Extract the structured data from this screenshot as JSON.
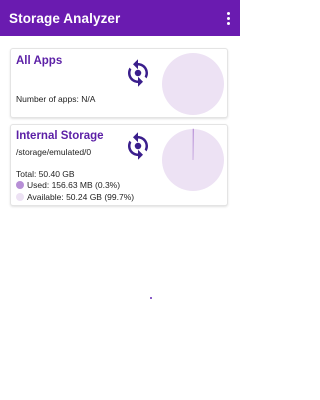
{
  "app": {
    "title": "Storage Analyzer"
  },
  "colors": {
    "accent": "#6a1bb0",
    "title_text": "#5b1fa6",
    "pie_free": "#ede2f4",
    "pie_used": "#b78fd6",
    "icon": "#3a1e8c"
  },
  "all_apps": {
    "title": "All Apps",
    "count_text": "Number of apps: N/A",
    "icon": "sync-icon"
  },
  "internal_storage": {
    "title": "Internal Storage",
    "path": "/storage/emulated/0",
    "total_text": "Total: 50.40 GB",
    "used_text": "Used: 156.63 MB (0.3%)",
    "available_text": "Available: 50.24 GB (99.7%)",
    "used_fraction": 0.003,
    "icon": "sync-icon"
  }
}
